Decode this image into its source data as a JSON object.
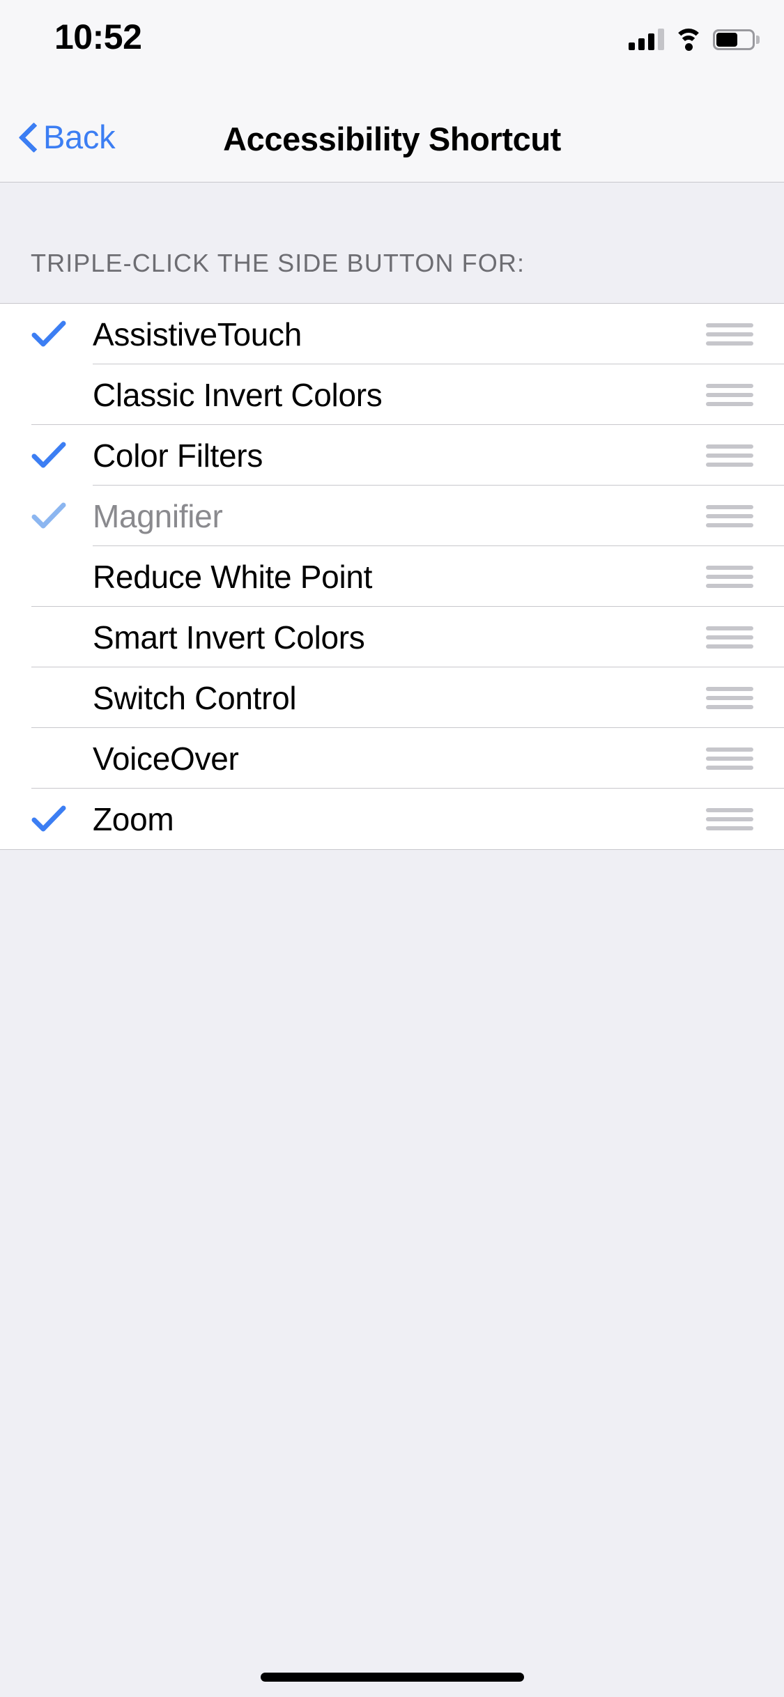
{
  "status_bar": {
    "time": "10:52",
    "signal_icon": "cellular-signal-icon",
    "signal_bars_filled": 3,
    "signal_bars_total": 4,
    "wifi_icon": "wifi-icon",
    "battery_icon": "battery-icon",
    "battery_level_percent": 60
  },
  "nav": {
    "back_label": "Back",
    "back_icon": "chevron-left-icon",
    "title": "Accessibility Shortcut"
  },
  "section": {
    "header": "TRIPLE-CLICK THE SIDE BUTTON FOR:"
  },
  "colors": {
    "accent_blue": "#3c7ef3",
    "accent_blue_dim": "#8cb6f0",
    "separator": "#c8c7cc",
    "group_background": "#efeff4",
    "row_background": "#ffffff",
    "header_text": "#6d6d72",
    "dim_text": "#8a8a8e",
    "handle_gray": "#c6c6cb"
  },
  "list": {
    "reorder_icon": "reorder-handle-icon",
    "check_icon": "checkmark-icon",
    "items": [
      {
        "label": "AssistiveTouch",
        "checked": true,
        "dimmed": false
      },
      {
        "label": "Classic Invert Colors",
        "checked": false,
        "dimmed": false
      },
      {
        "label": "Color Filters",
        "checked": true,
        "dimmed": false
      },
      {
        "label": "Magnifier",
        "checked": true,
        "dimmed": true
      },
      {
        "label": "Reduce White Point",
        "checked": false,
        "dimmed": false
      },
      {
        "label": "Smart Invert Colors",
        "checked": false,
        "dimmed": false
      },
      {
        "label": "Switch Control",
        "checked": false,
        "dimmed": false
      },
      {
        "label": "VoiceOver",
        "checked": false,
        "dimmed": false
      },
      {
        "label": "Zoom",
        "checked": true,
        "dimmed": false
      }
    ]
  },
  "home_indicator": {
    "name": "home-indicator"
  }
}
